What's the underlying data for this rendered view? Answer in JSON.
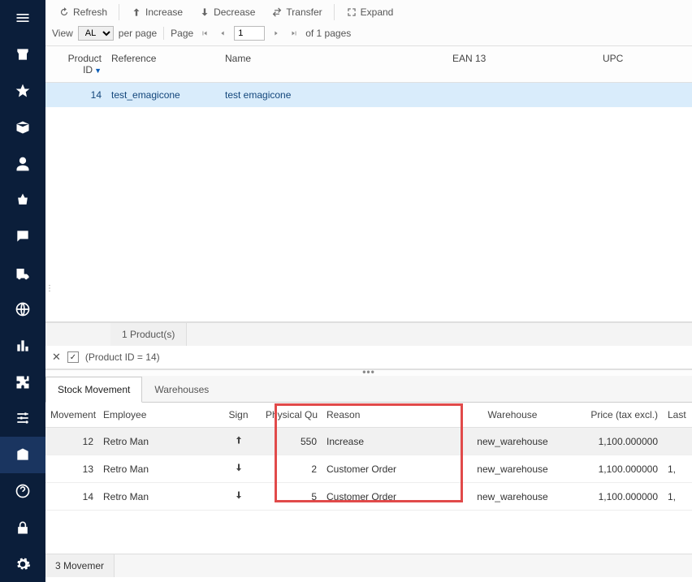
{
  "toolbar": {
    "refresh": "Refresh",
    "increase": "Increase",
    "decrease": "Decrease",
    "transfer": "Transfer",
    "expand": "Expand"
  },
  "pager": {
    "view_label": "View",
    "select_value": "ALL",
    "per_page": "per page",
    "page_label": "Page",
    "page_value": "1",
    "of_pages": "of 1 pages"
  },
  "grid": {
    "columns": {
      "product_id": "Product ID",
      "reference": "Reference",
      "name": "Name",
      "ean": "EAN 13",
      "upc": "UPC"
    },
    "rows": [
      {
        "product_id": "14",
        "reference": "test_emagicone",
        "name": "test emagicone",
        "ean": "",
        "upc": ""
      }
    ],
    "footer_count": "1 Product(s)"
  },
  "filter": {
    "text": "(Product ID = 14)"
  },
  "tabs": {
    "stock_movement": "Stock Movement",
    "warehouses": "Warehouses"
  },
  "detail": {
    "columns": {
      "movement_id": "Movement I",
      "employee": "Employee",
      "sign": "Sign",
      "physical_qty": "Physical Qu",
      "reason": "Reason",
      "warehouse": "Warehouse",
      "price": "Price (tax excl.)",
      "last": "Last"
    },
    "rows": [
      {
        "movement_id": "12",
        "employee": "Retro Man",
        "sign": "up",
        "qty": "550",
        "reason": "Increase",
        "warehouse": "new_warehouse",
        "price": "1,100.000000",
        "last": ""
      },
      {
        "movement_id": "13",
        "employee": "Retro Man",
        "sign": "down",
        "qty": "2",
        "reason": "Customer Order",
        "warehouse": "new_warehouse",
        "price": "1,100.000000",
        "last": "1,"
      },
      {
        "movement_id": "14",
        "employee": "Retro Man",
        "sign": "down",
        "qty": "5",
        "reason": "Customer Order",
        "warehouse": "new_warehouse",
        "price": "1,100.000000",
        "last": "1,"
      }
    ],
    "footer_count": "3 Movemer"
  }
}
